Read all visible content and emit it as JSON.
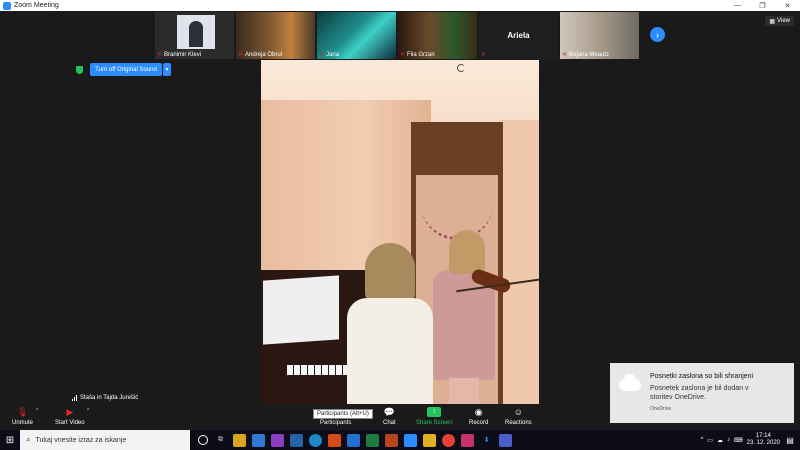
{
  "window": {
    "title": "Zoom Meeting",
    "controls": [
      "—",
      "❐",
      "✕"
    ]
  },
  "participants_strip": [
    {
      "name": "Branimir Klevi"
    },
    {
      "name": "Andreja Obrul"
    },
    {
      "name": "Jana"
    },
    {
      "name": "Fila Grzan"
    },
    {
      "name": "Ariela"
    },
    {
      "name": "Bojana Meautz"
    }
  ],
  "view_button": "View",
  "original_sound_button": "Turn off Original Sound",
  "speaker_label": "Staša in Tajda Jurešić",
  "toolbar": {
    "unmute": "Unmute",
    "start_video": "Start Video",
    "participants": "Participants",
    "chat": "Chat",
    "share_screen": "Share Screen",
    "record": "Record",
    "reactions": "Reactions"
  },
  "tooltip": "Participants (Alt+U)",
  "toast": {
    "title": "Posnetki zaslona so bili shranjeni",
    "body": "Posnetek zaslona je bil dodan v storitev OneDrive.",
    "source": "OneDrive"
  },
  "taskbar": {
    "search_placeholder": "Tukaj vnesite izraz za iskanje",
    "time": "17:14",
    "date": "23. 12. 2020"
  },
  "colors": {
    "zoom_blue": "#2d8cff",
    "share_green": "#25c45a",
    "mic_off_red": "#e02828"
  }
}
